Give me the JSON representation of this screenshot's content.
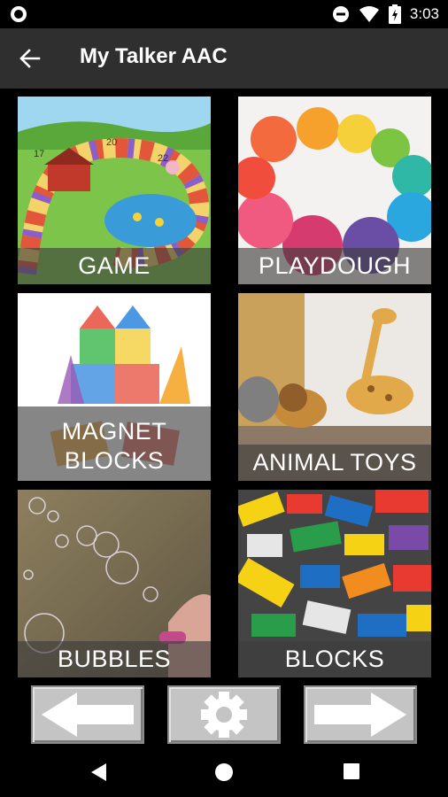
{
  "status_bar": {
    "time": "3:03",
    "icons": [
      "app-notification-icon",
      "do-not-disturb-icon",
      "wifi-icon",
      "battery-icon"
    ]
  },
  "app_bar": {
    "title": "My Talker AAC",
    "back_icon": "arrow-back-icon"
  },
  "tiles": [
    {
      "label": "GAME",
      "image": "board-game-picture"
    },
    {
      "label": "PLAYDOUGH",
      "image": "playdough-balls-picture"
    },
    {
      "label_line1": "MAGNET",
      "label_line2": "BLOCKS",
      "image": "magnet-blocks-picture"
    },
    {
      "label": "ANIMAL TOYS",
      "image": "animal-toys-picture"
    },
    {
      "label": "BUBBLES",
      "image": "bubbles-picture"
    },
    {
      "label": "BLOCKS",
      "image": "lego-blocks-picture"
    }
  ],
  "bottom_controls": [
    "previous-arrow-icon",
    "settings-gear-icon",
    "next-arrow-icon"
  ],
  "system_nav": [
    "back-triangle-icon",
    "home-circle-icon",
    "recents-square-icon"
  ],
  "colors": {
    "app_bar": "#2f2f2f",
    "caption_overlay": "#3c3c3c",
    "control_button": "#c4c4c4",
    "background": "#000000"
  }
}
